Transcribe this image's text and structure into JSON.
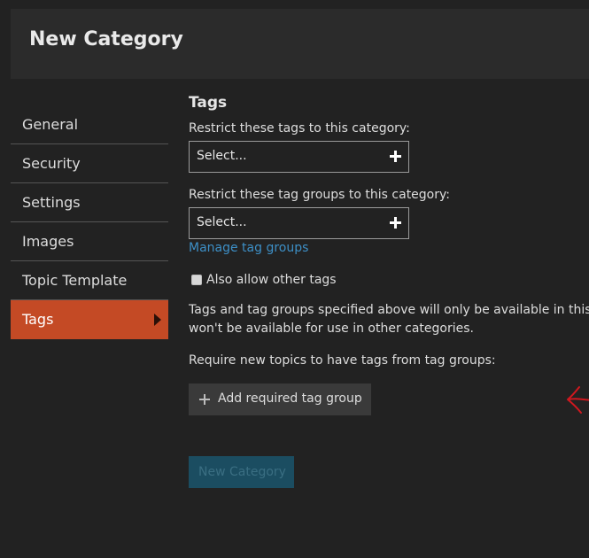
{
  "modal": {
    "title": "New Category"
  },
  "nav": {
    "items": [
      {
        "label": "General"
      },
      {
        "label": "Security"
      },
      {
        "label": "Settings"
      },
      {
        "label": "Images"
      },
      {
        "label": "Topic Template"
      },
      {
        "label": "Tags"
      }
    ],
    "active": "Tags"
  },
  "tags_tab": {
    "title": "Tags",
    "restrict_tags_label": "Restrict these tags to this category:",
    "restrict_tags_value": "Select...",
    "restrict_groups_label": "Restrict these tag groups to this category:",
    "restrict_groups_value": "Select...",
    "manage_link": "Manage tag groups",
    "allow_other_tags_label": "Also allow other tags",
    "allow_other_tags_checked": false,
    "help_line_1": "Tags and tag groups specified above will only be available in this c",
    "help_line_2": "won't be available for use in other categories.",
    "required_label": "Require new topics to have tags from tag groups:",
    "add_required_button": "Add required tag group"
  },
  "footer": {
    "submit_button": "New Category"
  },
  "colors": {
    "background": "#222222",
    "header_background": "#2b2b2b",
    "active_tab": "#c44a25",
    "link": "#3d8fc6",
    "primary_button_disabled": "#1b4d61",
    "annotation_arrow": "#d0181f"
  },
  "icons": {
    "select_add": "plus-icon",
    "active_indicator": "caret-right-icon",
    "add_button": "plus-icon",
    "annotation": "hand-drawn-arrow-icon"
  }
}
